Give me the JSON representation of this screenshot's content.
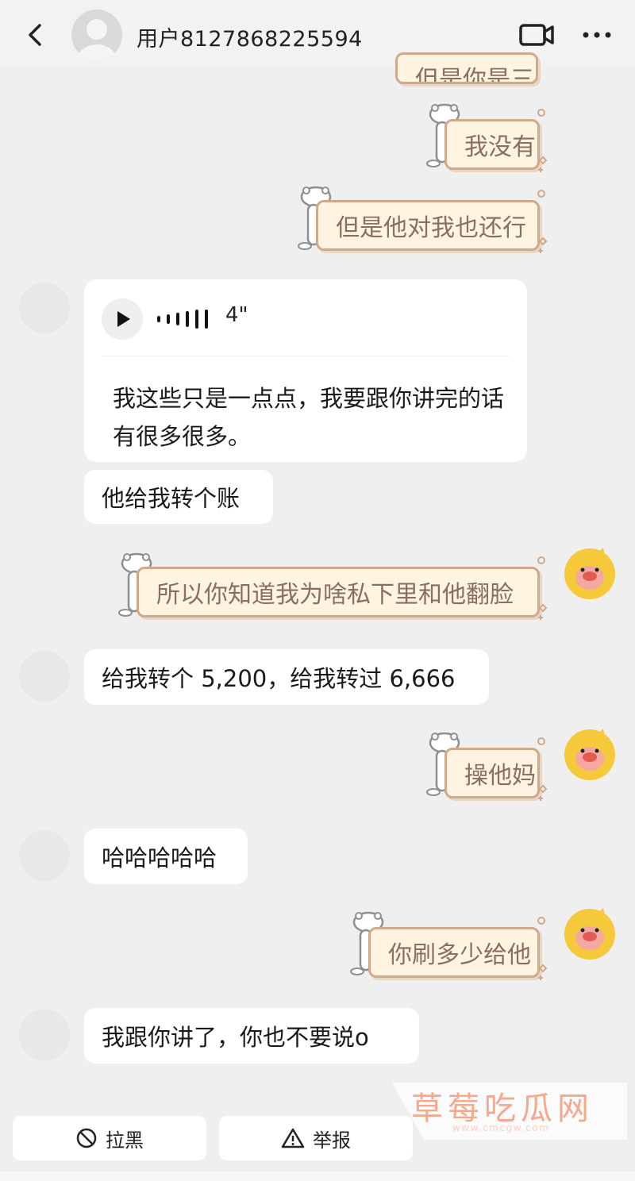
{
  "header": {
    "title": "用户8127868225594",
    "back_icon": "chevron-left-icon",
    "video_icon": "video-camera-icon",
    "more_icon": "more-dots-icon"
  },
  "messages": {
    "out_partial": "但是你是三",
    "out_1": "我没有",
    "out_2": "但是他对我也还行",
    "voice": {
      "duration": "4\"",
      "transcript": "我这些只是一点点，我要跟你讲完的话有很多很多。"
    },
    "in_1": "他给我转个账",
    "out_3": "所以你知道我为啥私下里和他翻脸",
    "in_2": "给我转个 5,200，给我转过 6,666",
    "out_4": "操他妈",
    "in_3": "哈哈哈哈哈",
    "out_5": "你刷多少给他",
    "in_4": "我跟你讲了，你也不要说o"
  },
  "actions": {
    "block_label": "拉黑",
    "report_label": "举报"
  },
  "watermark": {
    "title": "草莓吃瓜网",
    "url": "www.cmcgw.com"
  },
  "colors": {
    "sticker_bg": "#fff4e2",
    "sticker_border": "#cfa98a",
    "sticker_text": "#8a6f5b",
    "duck_yellow": "#f5c93a",
    "watermark": "#f4a88c"
  }
}
